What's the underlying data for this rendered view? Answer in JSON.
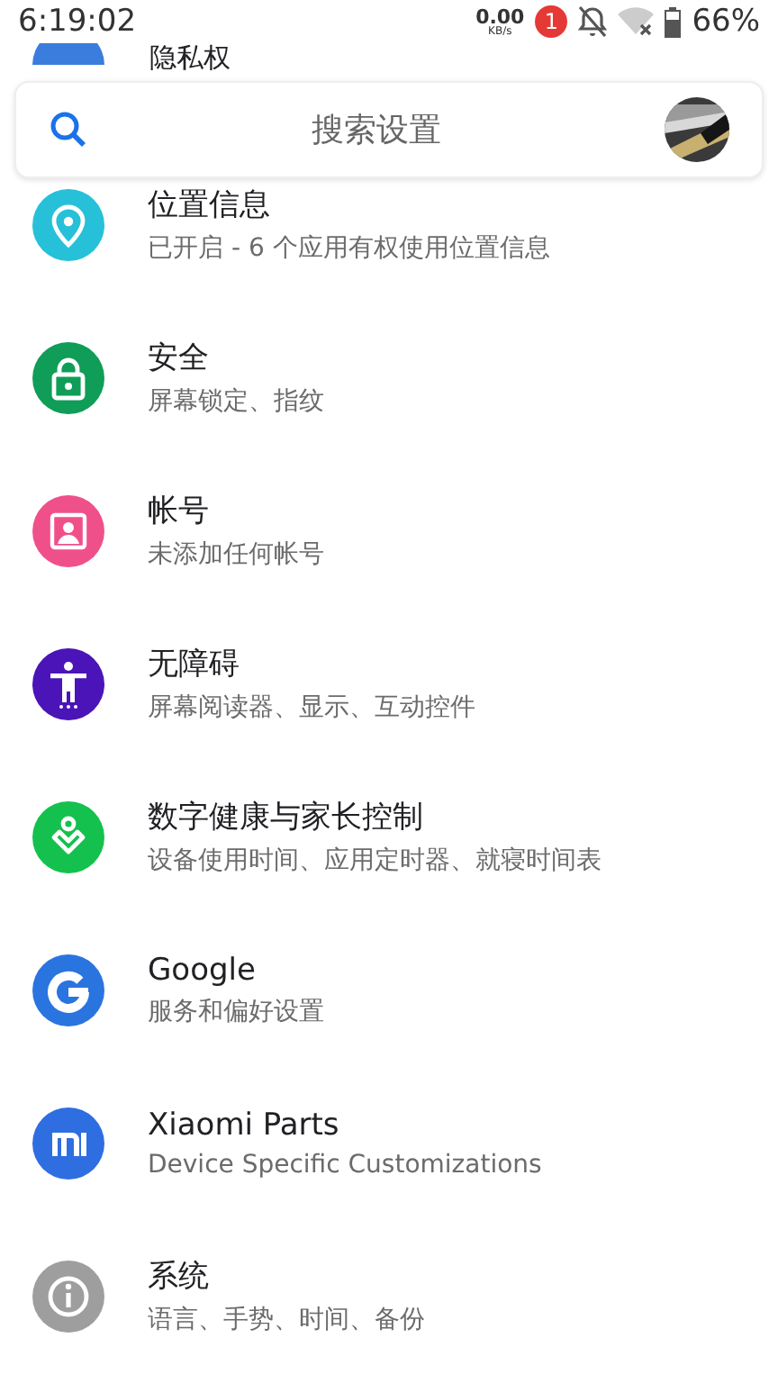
{
  "status_bar": {
    "time": "6:19:02",
    "net_speed": "0.00",
    "net_unit": "KB/s",
    "notification_count": "1",
    "battery": "66%"
  },
  "partial_item": {
    "title": "隐私权",
    "color": "#3b7ddd"
  },
  "search": {
    "placeholder": "搜索设置"
  },
  "items": [
    {
      "kind": "location",
      "title": "位置信息",
      "subtitle": "已开启 - 6 个应用有权使用位置信息",
      "color": "#26c1d9"
    },
    {
      "kind": "lock",
      "title": "安全",
      "subtitle": "屏幕锁定、指纹",
      "color": "#0f9d58"
    },
    {
      "kind": "account",
      "title": "帐号",
      "subtitle": "未添加任何帐号",
      "color": "#f0508a"
    },
    {
      "kind": "accessibility",
      "title": "无障碍",
      "subtitle": "屏幕阅读器、显示、互动控件",
      "color": "#4a14b8"
    },
    {
      "kind": "wellbeing",
      "title": "数字健康与家长控制",
      "subtitle": "设备使用时间、应用定时器、就寝时间表",
      "color": "#14c14e"
    },
    {
      "kind": "google",
      "title": "Google",
      "subtitle": "服务和偏好设置",
      "color": "#2a74e0"
    },
    {
      "kind": "mi",
      "title": "Xiaomi Parts",
      "subtitle": "Device Specific Customizations",
      "color": "#2f6ee0"
    },
    {
      "kind": "info",
      "title": "系统",
      "subtitle": "语言、手势、时间、备份",
      "color": "#9e9e9e"
    }
  ]
}
